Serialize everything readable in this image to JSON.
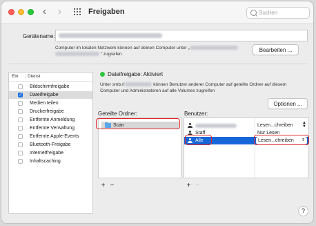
{
  "window": {
    "title": "Freigaben"
  },
  "search": {
    "placeholder": "Suchen"
  },
  "computer_name": {
    "label": "Gerätename:",
    "description_1": "Computer im lokalen Netzwerk können auf deinen Computer unter „",
    "description_2": "“ zugreifen",
    "edit_label": "Bearbeiten ..."
  },
  "services": {
    "col_on": "Ein",
    "col_service": "Dienst",
    "items": [
      {
        "label": "Bildschirmfreigabe",
        "checked": false
      },
      {
        "label": "Dateifreigabe",
        "checked": true
      },
      {
        "label": "Medien teilen",
        "checked": false
      },
      {
        "label": "Druckerfreigabe",
        "checked": false
      },
      {
        "label": "Entfernte Anmeldung",
        "checked": false
      },
      {
        "label": "Entfernte Verwaltung",
        "checked": false
      },
      {
        "label": "Entfernte Apple-Events",
        "checked": false
      },
      {
        "label": "Bluetooth-Freigabe",
        "checked": false
      },
      {
        "label": "Internetfreigabe",
        "checked": false
      },
      {
        "label": "Inhaltscaching",
        "checked": false
      }
    ]
  },
  "status": {
    "title": "Dateifreigabe: Aktiviert",
    "desc_prefix": "Unter smb://",
    "desc_rest": " können Benutzer anderer Computer auf geteilte Ordner auf diesem Computer und Administratoren auf alle Volumes zugreifen"
  },
  "options_label": "Optionen ...",
  "folders": {
    "label": "Geteilte Ordner:",
    "items": [
      {
        "name": "Scan"
      }
    ]
  },
  "users": {
    "label": "Benutzer:",
    "items": [
      {
        "name": "",
        "permission": "Lesen...chreiben"
      },
      {
        "name": "Staff",
        "permission": "Nur Lesen"
      },
      {
        "name": "Alle",
        "permission": "Lesen...chreiben"
      }
    ]
  },
  "buttons": {
    "add": "+",
    "remove": "−"
  },
  "help_label": "?",
  "colors": {
    "accent": "#1566d8",
    "highlight": "#e0262c",
    "status_green": "#2dc63f"
  }
}
